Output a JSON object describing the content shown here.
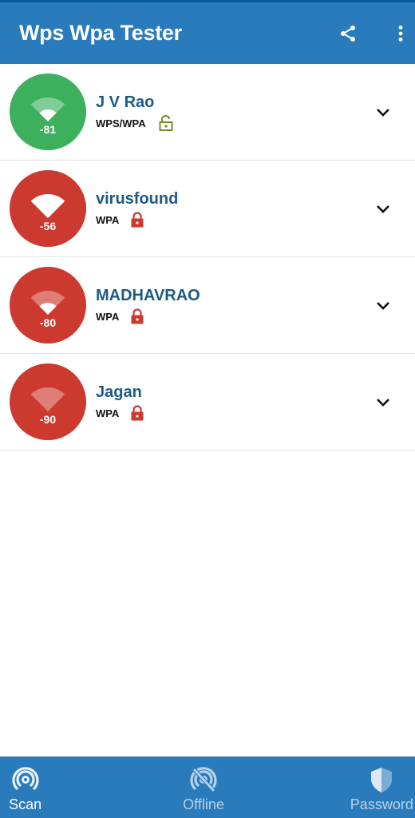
{
  "appbar": {
    "title": "Wps Wpa Tester",
    "actions": [
      {
        "icon": "share-icon"
      },
      {
        "icon": "more-vert-icon"
      }
    ]
  },
  "colors": {
    "primary": "#2a7bbb",
    "open_network": "#3db05e",
    "secured_network": "#cc3a2f",
    "ssid_text": "#1c5a85",
    "unlock_icon": "#7a8a22",
    "lock_icon": "#cc3a2f"
  },
  "networks": [
    {
      "ssid": "J V Rao",
      "security": "WPS/WPA",
      "rssi": "-81",
      "signal_level": 2,
      "signal_max": 4,
      "lock_state": "unlocked",
      "badge_color": "green"
    },
    {
      "ssid": "virusfound",
      "security": "WPA",
      "rssi": "-56",
      "signal_level": 4,
      "signal_max": 4,
      "lock_state": "locked",
      "badge_color": "red"
    },
    {
      "ssid": "MADHAVRAO",
      "security": "WPA",
      "rssi": "-80",
      "signal_level": 2,
      "signal_max": 4,
      "lock_state": "locked",
      "badge_color": "red"
    },
    {
      "ssid": "Jagan",
      "security": "WPA",
      "rssi": "-90",
      "signal_level": 0,
      "signal_max": 4,
      "lock_state": "locked",
      "badge_color": "red"
    }
  ],
  "bottom_nav": {
    "items": [
      {
        "label": "Scan",
        "icon": "scan-icon",
        "active": true
      },
      {
        "label": "Offline",
        "icon": "offline-icon",
        "active": false
      },
      {
        "label": "Password",
        "icon": "shield-icon",
        "active": false
      }
    ]
  }
}
